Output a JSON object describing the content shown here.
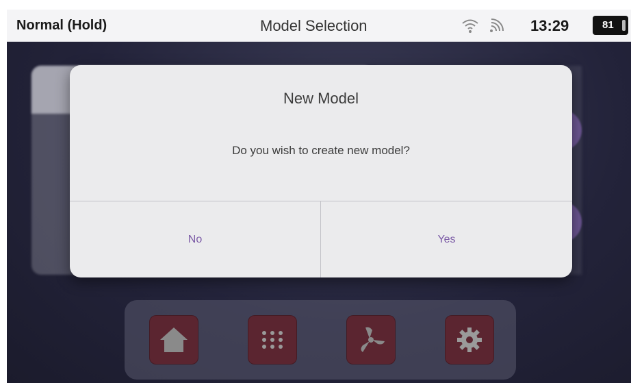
{
  "status_bar": {
    "mode": "Normal (Hold)",
    "title": "Model Selection",
    "time": "13:29",
    "battery": "81",
    "icons": [
      "wifi-icon",
      "signal-icon",
      "battery-icon"
    ]
  },
  "dialog": {
    "title": "New Model",
    "message": "Do you wish to create new model?",
    "buttons": {
      "no": "No",
      "yes": "Yes"
    },
    "button_color": "#7b5aa6"
  },
  "dock": {
    "items": [
      {
        "icon": "home-icon"
      },
      {
        "icon": "grid-apps-icon"
      },
      {
        "icon": "fan-icon"
      },
      {
        "icon": "gear-icon"
      }
    ],
    "button_color": "#5b2530"
  }
}
